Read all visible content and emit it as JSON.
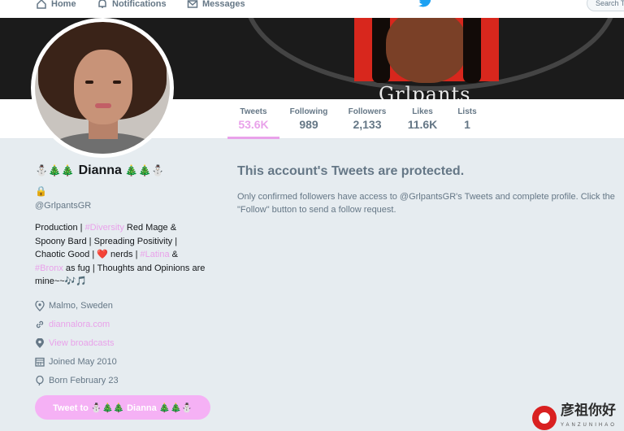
{
  "nav": {
    "home": "Home",
    "notifications": "Notifications",
    "messages": "Messages",
    "search_placeholder": "Search T"
  },
  "banner": {
    "text": "Grlpants"
  },
  "stats": {
    "tweets": {
      "label": "Tweets",
      "value": "53.6K"
    },
    "following": {
      "label": "Following",
      "value": "989"
    },
    "followers": {
      "label": "Followers",
      "value": "2,133"
    },
    "likes": {
      "label": "Likes",
      "value": "11.6K"
    },
    "lists": {
      "label": "Lists",
      "value": "1"
    }
  },
  "profile": {
    "name_prefix": "⛄🎄🎄",
    "name": "Dianna",
    "name_suffix": "🎄🎄⛄",
    "lock": "🔒",
    "handle": "@GrlpantsGR",
    "bio": {
      "part1": "Production | ",
      "tag1": "#Diversity",
      "part2": " Red Mage & Spoony Bard | Spreading Positivity | Chaotic Good | ",
      "heart": "❤️",
      "part3": " nerds | ",
      "tag2": "#Latina",
      "part4": " & ",
      "tag3": "#Bronx",
      "part5": " as fug | Thoughts and Opinions are mine~~",
      "notes": "🎶🎵"
    },
    "location": "Malmo, Sweden",
    "website": "diannalora.com",
    "broadcasts": "View broadcasts",
    "joined": "Joined May 2010",
    "born": "Born February 23",
    "tweet_to": "Tweet to ⛄🎄🎄 Dianna 🎄🎄⛄"
  },
  "protected": {
    "title": "This account's Tweets are protected.",
    "body": "Only confirmed followers have access to @GrlpantsGR's Tweets and complete profile. Click the \"Follow\" button to send a follow request."
  },
  "watermark": {
    "main": "彦祖你好",
    "sub": "YANZUNIHAO"
  },
  "colors": {
    "accent": "#e9a2ea",
    "button": "#f5b1f5",
    "background": "#e6ecf0",
    "muted": "#657786"
  }
}
